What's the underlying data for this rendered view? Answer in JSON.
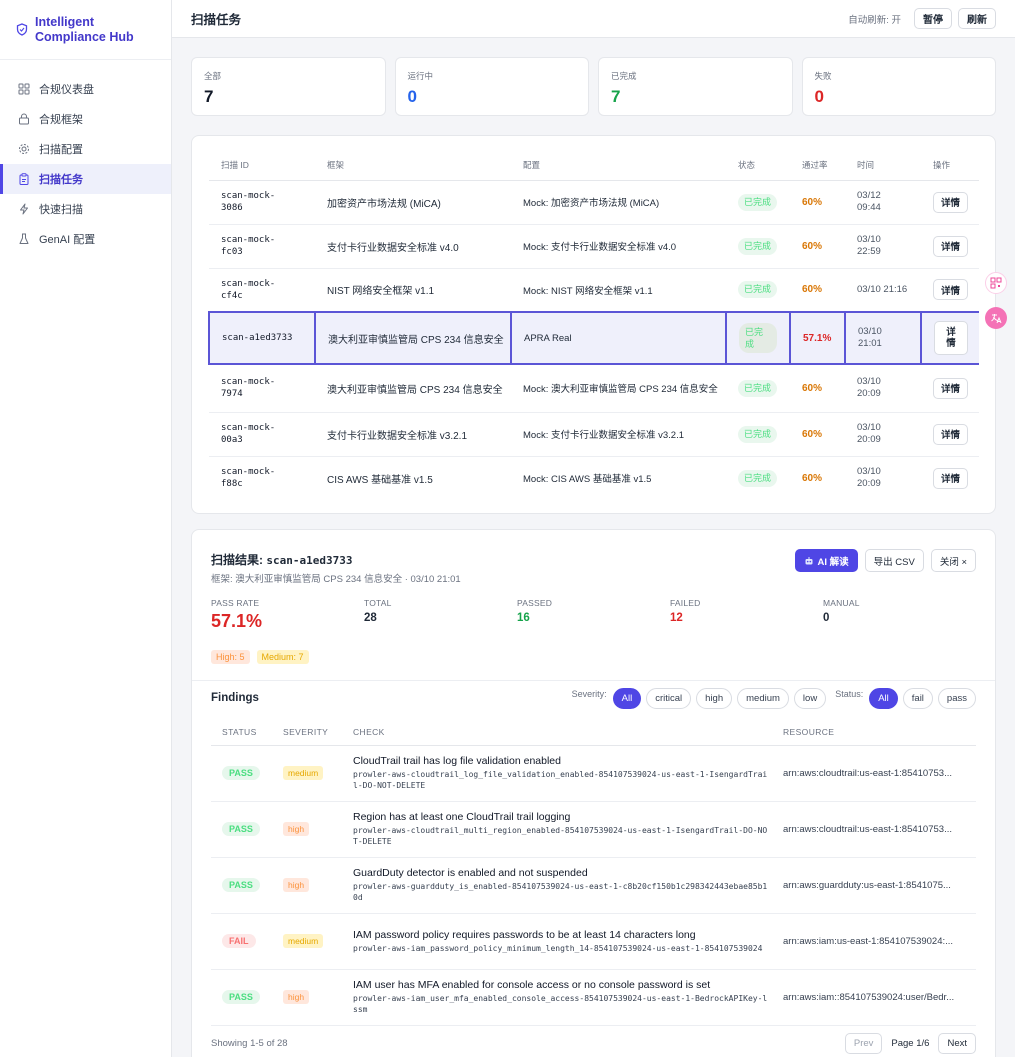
{
  "app": {
    "name_line1": "Intelligent",
    "name_line2": "Compliance Hub",
    "brand_color": "#4338ca"
  },
  "sidebar": {
    "items": [
      {
        "label": "合规仪表盘",
        "icon": "grid-icon"
      },
      {
        "label": "合规框架",
        "icon": "lock-icon"
      },
      {
        "label": "扫描配置",
        "icon": "gear-icon"
      },
      {
        "label": "扫描任务",
        "icon": "clipboard-icon",
        "active": true
      },
      {
        "label": "快速扫描",
        "icon": "lightning-icon"
      },
      {
        "label": "GenAI 配置",
        "icon": "flask-icon"
      }
    ]
  },
  "header": {
    "title": "扫描任务",
    "auto_refresh": "自动刷新: 开",
    "pause": "暂停",
    "refresh": "刷新"
  },
  "stats": [
    {
      "label": "全部",
      "value": "7",
      "color": "#111827"
    },
    {
      "label": "运行中",
      "value": "0",
      "color": "#2563eb"
    },
    {
      "label": "已完成",
      "value": "7",
      "color": "#16a34a"
    },
    {
      "label": "失败",
      "value": "0",
      "color": "#dc2626"
    }
  ],
  "tasks": {
    "headers": {
      "id": "扫描 ID",
      "framework": "框架",
      "config": "配置",
      "status": "状态",
      "rate": "通过率",
      "time": "时间",
      "action": "操作"
    },
    "detail_label": "详情",
    "rows": [
      {
        "id1": "scan-mock-",
        "id2": "3086",
        "framework": "加密资产市场法规 (MiCA)",
        "config": "Mock: 加密资产市场法规 (MiCA)",
        "status": "已完成",
        "rate": "60%",
        "time1": "03/12",
        "time2": "09:44"
      },
      {
        "id1": "scan-mock-",
        "id2": "fc03",
        "framework": "支付卡行业数据安全标准 v4.0",
        "config": "Mock: 支付卡行业数据安全标准 v4.0",
        "status": "已完成",
        "rate": "60%",
        "time1": "03/10",
        "time2": "22:59"
      },
      {
        "id1": "scan-mock-",
        "id2": "cf4c",
        "framework": "NIST 网络安全框架 v1.1",
        "config": "Mock: NIST 网络安全框架 v1.1",
        "status": "已完成",
        "rate": "60%",
        "time1": "03/10 21:16",
        "time2": ""
      },
      {
        "id1": "scan-a1ed3733",
        "id2": "",
        "framework": "澳大利亚审慎监管局 CPS 234 信息安全",
        "config": "APRA Real",
        "status": "已完成",
        "rate": "57.1%",
        "time1": "03/10",
        "time2": "21:01",
        "selected": true
      },
      {
        "id1": "scan-mock-",
        "id2": "7974",
        "framework": "澳大利亚审慎监管局 CPS 234 信息安全",
        "config": "Mock: 澳大利亚审慎监管局 CPS 234 信息安全",
        "status": "已完成",
        "rate": "60%",
        "time1": "03/10",
        "time2": "20:09"
      },
      {
        "id1": "scan-mock-",
        "id2": "00a3",
        "framework": "支付卡行业数据安全标准 v3.2.1",
        "config": "Mock: 支付卡行业数据安全标准 v3.2.1",
        "status": "已完成",
        "rate": "60%",
        "time1": "03/10",
        "time2": "20:09"
      },
      {
        "id1": "scan-mock-",
        "id2": "f88c",
        "framework": "CIS AWS 基础基准 v1.5",
        "config": "Mock: CIS AWS 基础基准 v1.5",
        "status": "已完成",
        "rate": "60%",
        "time1": "03/10",
        "time2": "20:09"
      }
    ]
  },
  "result": {
    "title_prefix": "扫描结果:",
    "scan_id": "scan-a1ed3733",
    "subtitle": "框架: 澳大利亚审慎监管局 CPS 234 信息安全 · 03/10 21:01",
    "ai_button": "AI 解读",
    "export_button": "导出 CSV",
    "close_button": "关闭 ×",
    "metrics": {
      "pass_rate_label": "PASS RATE",
      "pass_rate": "57.1%",
      "total_label": "TOTAL",
      "total": "28",
      "passed_label": "PASSED",
      "passed": "16",
      "failed_label": "FAILED",
      "failed": "12",
      "manual_label": "MANUAL",
      "manual": "0"
    },
    "tags": {
      "high": "High: 5",
      "medium": "Medium: 7"
    },
    "findings_title": "Findings",
    "severity_label": "Severity:",
    "severity_options": [
      "All",
      "critical",
      "high",
      "medium",
      "low"
    ],
    "status_label": "Status:",
    "status_options": [
      "All",
      "fail",
      "pass"
    ],
    "columns": {
      "status": "STATUS",
      "severity": "SEVERITY",
      "check": "CHECK",
      "resource": "RESOURCE"
    },
    "findings": [
      {
        "status": "PASS",
        "severity": "medium",
        "title": "CloudTrail trail has log file validation enabled",
        "id": "prowler-aws-cloudtrail_log_file_validation_enabled-854107539024-us-east-1-IsengardTrail-DO-NOT-DELETE",
        "resource": "arn:aws:cloudtrail:us-east-1:85410753..."
      },
      {
        "status": "PASS",
        "severity": "high",
        "title": "Region has at least one CloudTrail trail logging",
        "id": "prowler-aws-cloudtrail_multi_region_enabled-854107539024-us-east-1-IsengardTrail-DO-NOT-DELETE",
        "resource": "arn:aws:cloudtrail:us-east-1:85410753..."
      },
      {
        "status": "PASS",
        "severity": "high",
        "title": "GuardDuty detector is enabled and not suspended",
        "id": "prowler-aws-guardduty_is_enabled-854107539024-us-east-1-c8b20cf150b1c298342443ebae85b10d",
        "resource": "arn:aws:guardduty:us-east-1:8541075..."
      },
      {
        "status": "FAIL",
        "severity": "medium",
        "title": "IAM password policy requires passwords to be at least 14 characters long",
        "id": "prowler-aws-iam_password_policy_minimum_length_14-854107539024-us-east-1-854107539024",
        "resource": "arn:aws:iam:us-east-1:854107539024:..."
      },
      {
        "status": "PASS",
        "severity": "high",
        "title": "IAM user has MFA enabled for console access or no console password is set",
        "id": "prowler-aws-iam_user_mfa_enabled_console_access-854107539024-us-east-1-BedrockAPIKey-lssm",
        "resource": "arn:aws:iam::854107539024:user/Bedr..."
      }
    ],
    "pager": {
      "info": "Showing 1-5 of 28",
      "prev": "Prev",
      "page": "Page 1/6",
      "next": "Next"
    }
  }
}
